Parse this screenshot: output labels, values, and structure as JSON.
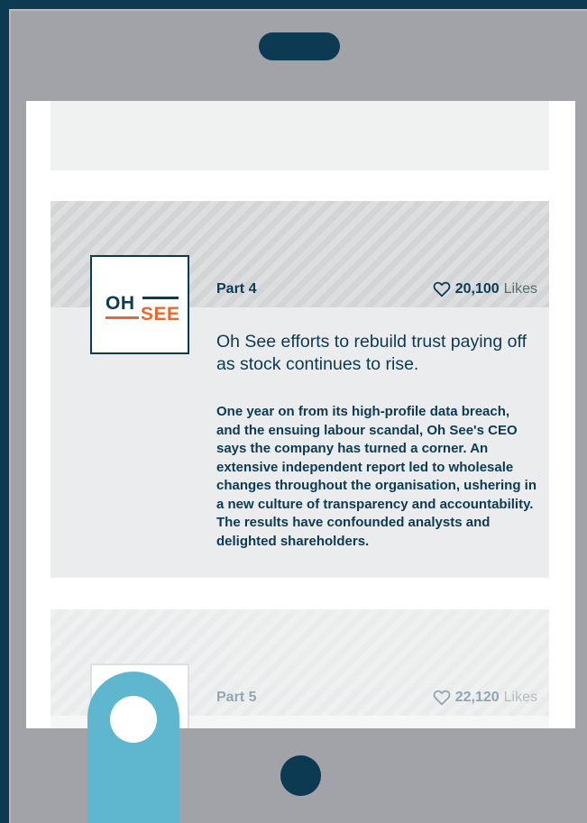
{
  "card1": {
    "part": "Part 4",
    "likes_count": "20,100",
    "likes_label": "Likes",
    "logo_oh": "OH",
    "logo_see": "SEE",
    "headline": "Oh See efforts to rebuild trust paying off as stock continues to rise.",
    "body": "One year on from its high-profile data breach, and the ensuing labour scandal, Oh See's CEO says the company has turned a corner. An extensive independent report led to wholesale changes throughout the organisation, ushering in a new culture of transparency and accountability. The results have confounded analysts and delighted shareholders."
  },
  "card2": {
    "part": "Part 5",
    "likes_count": "22,120",
    "likes_label": "Likes"
  },
  "colors": {
    "navy": "#0c3a52",
    "orange": "#e8692b",
    "slider": "#5fb7cf",
    "device": "#a2a3a8"
  },
  "icons": {
    "likes": "heart-outline-icon"
  }
}
